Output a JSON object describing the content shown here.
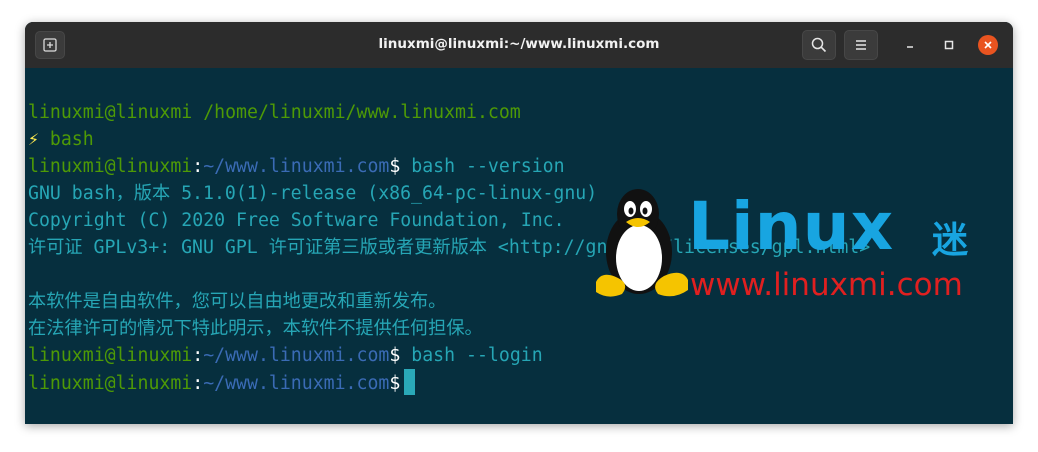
{
  "window": {
    "title": "linuxmi@linuxmi:~/www.linuxmi.com",
    "buttons": {
      "new_tab_icon": "new-tab-icon",
      "search_icon": "search-icon",
      "menu_icon": "hamburger-menu-icon",
      "minimize_icon": "minimize-icon",
      "maximize_icon": "maximize-icon",
      "close_icon": "close-icon"
    },
    "colors": {
      "titlebar": "#2c2c2c",
      "terminal_bg": "#062f3e",
      "close_button": "#e95420",
      "prompt_green": "#4e9a06",
      "path_blue": "#3a6bb5",
      "output_cyan": "#26a6b5",
      "cursor": "#2aa9b8"
    }
  },
  "terminal": {
    "header_user": "linuxmi@linuxmi",
    "header_path": "/home/linuxmi/www.linuxmi.com",
    "bash_icon": "⚡",
    "bash_label": "bash",
    "prompt_user": "linuxmi@linuxmi",
    "prompt_sep": ":",
    "prompt_path": "~/www.linuxmi.com",
    "prompt_symbol": "$",
    "cmd1": "bash --version",
    "out1": "GNU bash，版本 5.1.0(1)-release (x86_64-pc-linux-gnu)",
    "out2": "Copyright (C) 2020 Free Software Foundation, Inc.",
    "out3": "许可证 GPLv3+: GNU GPL 许可证第三版或者更新版本 <http://gnu.org/licenses/gpl.html>",
    "out4": "",
    "out5": "本软件是自由软件，您可以自由地更改和重新发布。",
    "out6": "在法律许可的情况下特此明示，本软件不提供任何担保。",
    "cmd2": "bash --login",
    "cmd3": ""
  },
  "watermark": {
    "logo_text": "Linux",
    "logo_char": "迷",
    "url": "www.linuxmi.com",
    "logo_color": "#18a5e1",
    "url_color": "#e02020"
  }
}
